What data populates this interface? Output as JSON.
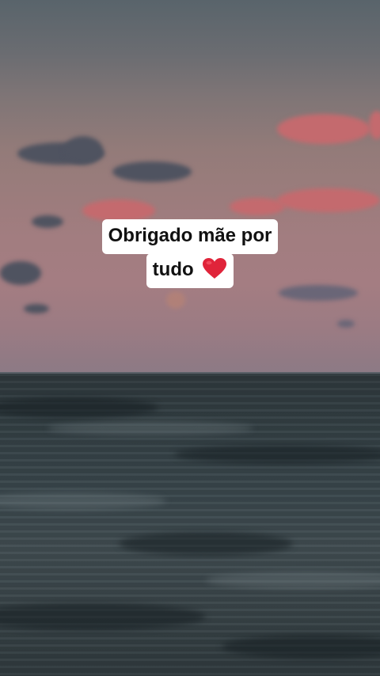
{
  "caption": {
    "line1": "Obrigado mãe por",
    "line2": "tudo",
    "emoji": "heart-icon"
  },
  "colors": {
    "caption_background": "#ffffff",
    "caption_text": "#111111",
    "heart": "#e0243a"
  }
}
